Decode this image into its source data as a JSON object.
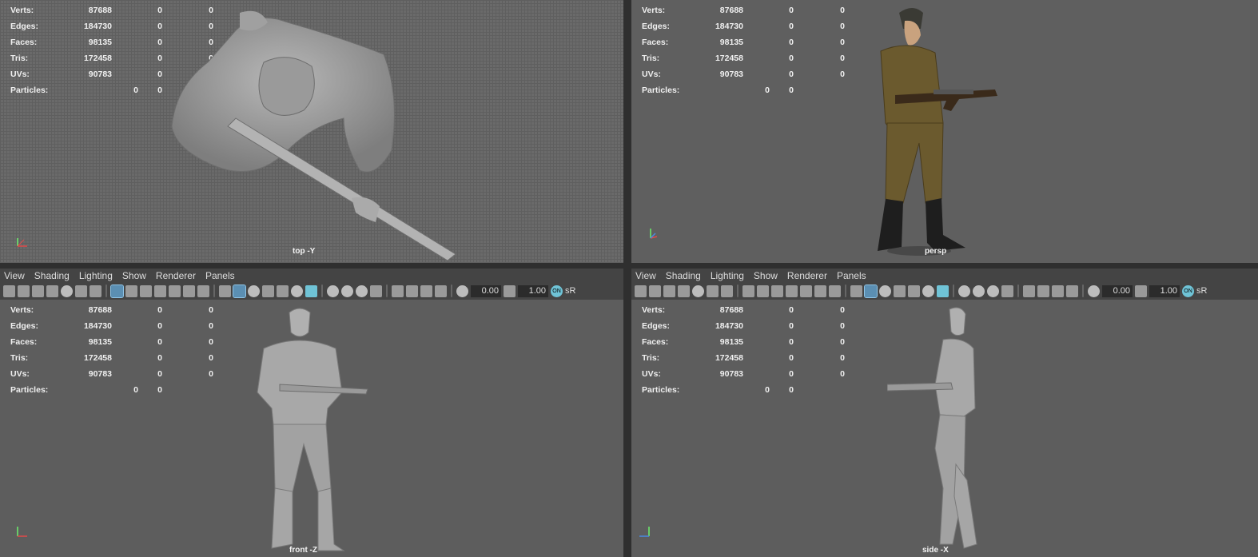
{
  "menus": [
    "View",
    "Shading",
    "Lighting",
    "Show",
    "Renderer",
    "Panels"
  ],
  "toolbar": {
    "exposure": "0.00",
    "gamma": "1.00",
    "srgb_label": "sR",
    "on_label": "ON"
  },
  "stats_labels": {
    "verts": "Verts:",
    "edges": "Edges:",
    "faces": "Faces:",
    "tris": "Tris:",
    "uvs": "UVs:",
    "particles": "Particles:"
  },
  "stats_values": {
    "verts": [
      "87688",
      "0",
      "0"
    ],
    "edges": [
      "184730",
      "0",
      "0"
    ],
    "faces": [
      "98135",
      "0",
      "0"
    ],
    "tris": [
      "172458",
      "0",
      "0"
    ],
    "uvs": [
      "90783",
      "0",
      "0"
    ],
    "particles": [
      "0",
      "0"
    ]
  },
  "viewports": {
    "top": {
      "camera": "top -Y"
    },
    "persp": {
      "camera": "persp"
    },
    "front": {
      "camera": "front -Z"
    },
    "side": {
      "camera": "side -X"
    }
  },
  "colors": {
    "viewport_bg": "#5d5d5d",
    "toolbar_bg": "#444444",
    "accent": "#6fc3d6",
    "model_gray": "#a8a8a8",
    "uniform": "#6b5a2e"
  },
  "icons": [
    "camera-icon",
    "lock-icon",
    "bookmark-icon",
    "grid-icon",
    "film-gate-icon",
    "resolution-gate-icon",
    "safe-area-icon",
    "wireframe-icon",
    "smooth-shade-icon",
    "lights-icon",
    "shadow-icon",
    "isolate-icon",
    "xray-icon",
    "exposure-icon",
    "gamma-icon"
  ]
}
